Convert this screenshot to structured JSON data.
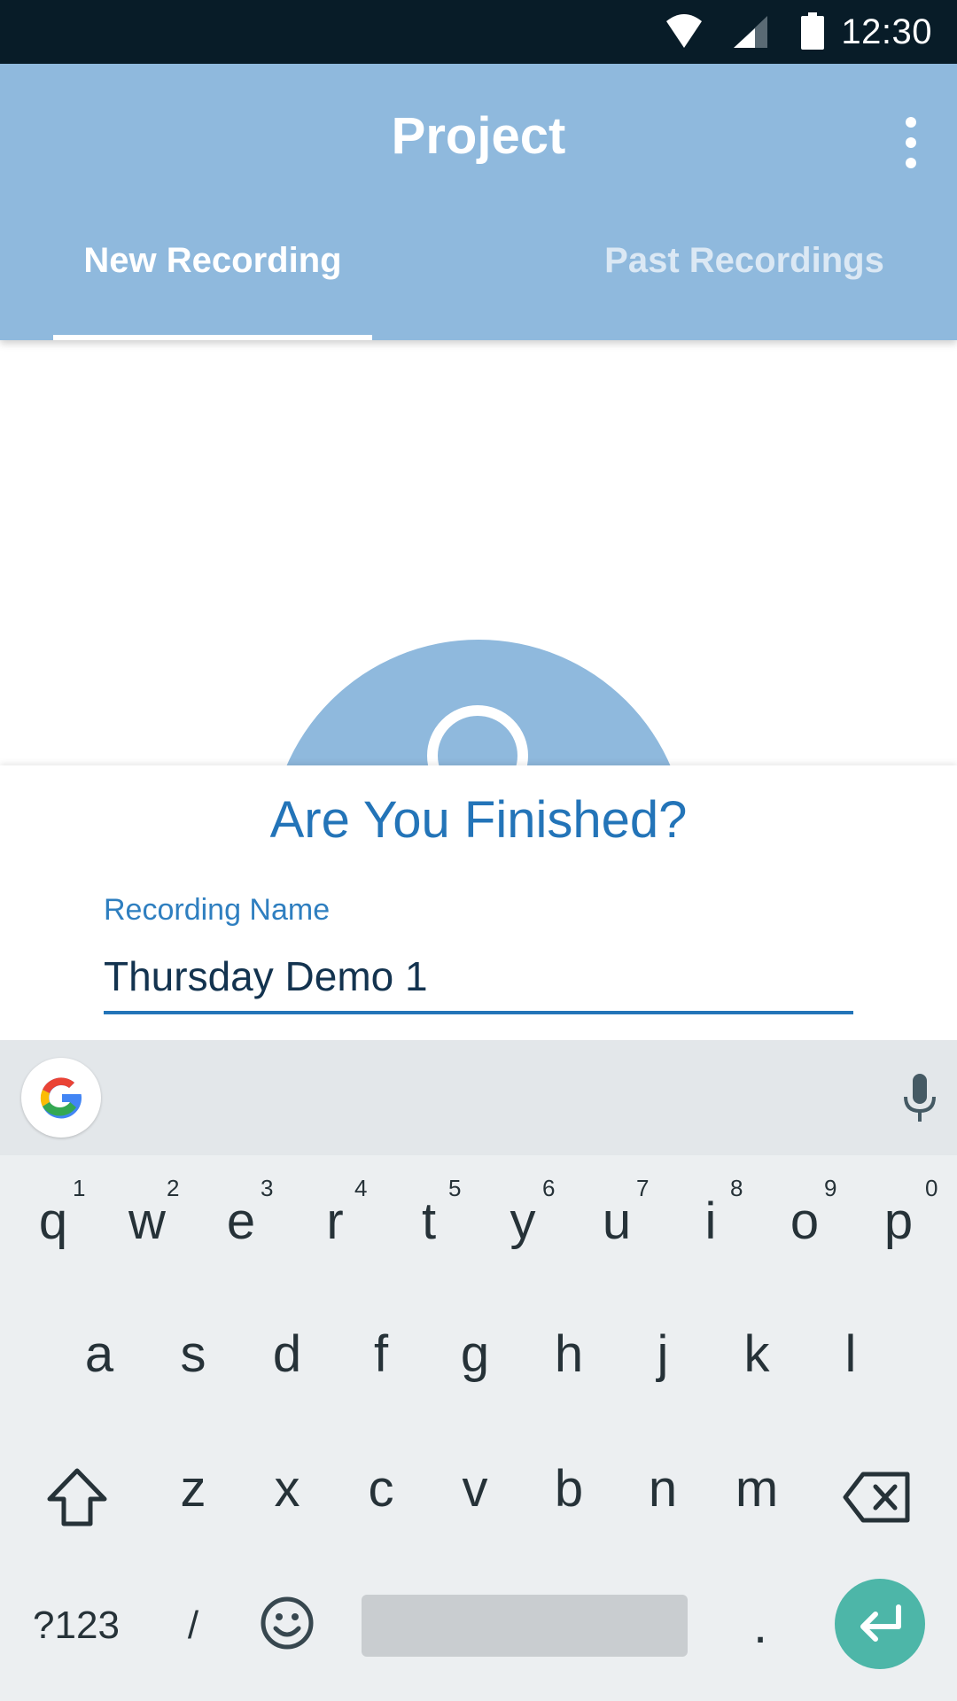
{
  "status_bar": {
    "time": "12:30",
    "icons": [
      "wifi-icon",
      "cell-signal-icon",
      "battery-icon"
    ]
  },
  "app_bar": {
    "title": "Project",
    "menu_icon": "overflow-menu-icon",
    "tabs": [
      {
        "label": "New Recording",
        "selected": true
      },
      {
        "label": "Past Recordings",
        "selected": false
      }
    ]
  },
  "record_button": {
    "icon": "record-icon"
  },
  "dialog": {
    "title": "Are You Finished?",
    "field_label": "Recording Name",
    "field_value": "Thursday Demo 1"
  },
  "keyboard": {
    "row1": [
      "q",
      "w",
      "e",
      "r",
      "t",
      "y",
      "u",
      "i",
      "o",
      "p"
    ],
    "row1_hints": [
      "1",
      "2",
      "3",
      "4",
      "5",
      "6",
      "7",
      "8",
      "9",
      "0"
    ],
    "row2": [
      "a",
      "s",
      "d",
      "f",
      "g",
      "h",
      "j",
      "k",
      "l"
    ],
    "row3": [
      "z",
      "x",
      "c",
      "v",
      "b",
      "n",
      "m"
    ],
    "symbols_key": "?123",
    "slash_key": "/",
    "period_key": ".",
    "icons": [
      "google-icon",
      "mic-icon",
      "shift-icon",
      "backspace-icon",
      "emoji-icon",
      "enter-icon"
    ]
  },
  "colors": {
    "status_bar": "#081c28",
    "app_bar": "#8fb9dd",
    "accent": "#2374b8",
    "enter_key": "#4db6a8"
  }
}
